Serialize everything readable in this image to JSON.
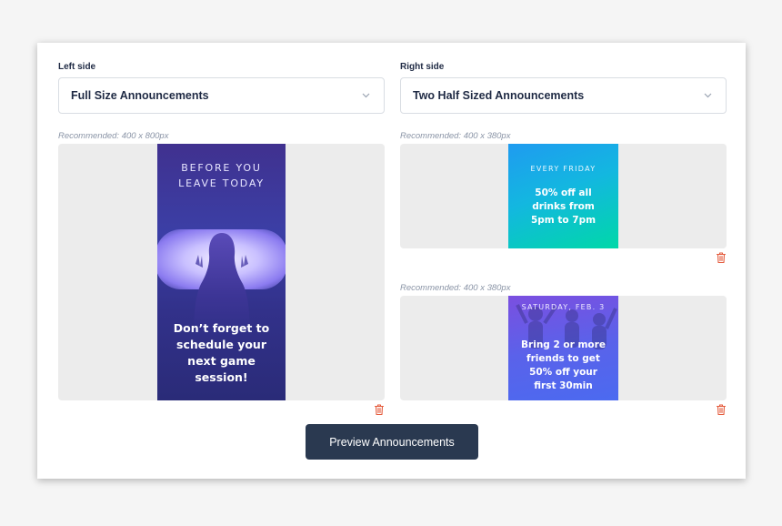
{
  "left": {
    "label": "Left side",
    "select_value": "Full Size Announcements",
    "recommended": "Recommended: 400 x 800px",
    "announcement": {
      "kicker_line1": "BEFORE YOU",
      "kicker_line2": "LEAVE TODAY",
      "message_lines": [
        "Don’t forget to",
        "schedule your",
        "next game",
        "session!"
      ]
    }
  },
  "right": {
    "label": "Right side",
    "select_value": "Two Half Sized Announcements",
    "slots": [
      {
        "recommended": "Recommended: 400 x 380px",
        "kicker": "EVERY FRIDAY",
        "message_lines": [
          "50% off all",
          "drinks from",
          "5pm to 7pm"
        ]
      },
      {
        "recommended": "Recommended: 400 x 380px",
        "kicker": "SATURDAY, FEB. 3",
        "message_lines": [
          "Bring 2 or more",
          "friends to get",
          "50% off your",
          "first 30min"
        ]
      }
    ]
  },
  "preview_button": "Preview Announcements",
  "icons": {
    "select_arrow": "chevron-down-icon",
    "delete": "trash-icon"
  },
  "colors": {
    "button": "#2a3950",
    "trash": "#e45b3c",
    "text": "#1f2a44",
    "muted": "#8a94a6"
  }
}
